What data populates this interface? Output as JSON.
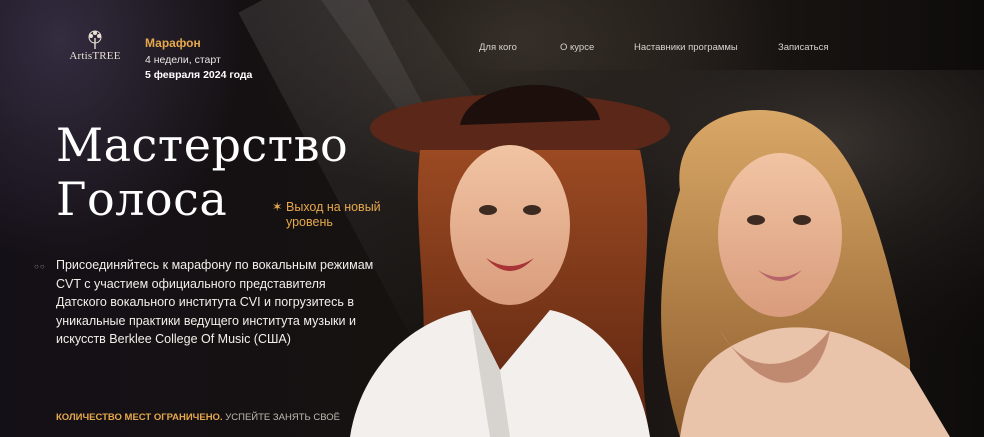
{
  "header": {
    "logo_text": "ArtisTREE",
    "marathon": {
      "title": "Марафон",
      "subtitle": "4 недели, старт",
      "date": "5 февраля 2024 года"
    },
    "nav": [
      {
        "label": "Для кого"
      },
      {
        "label": "О курсе"
      },
      {
        "label": "Наставники программы"
      },
      {
        "label": "Записаться"
      }
    ]
  },
  "hero": {
    "title_line1": "Мастерство",
    "title_line2": "Голоса",
    "tagline": "Выход на новый уровень",
    "description": "Присоединяйтесь к марафону по вокальным режимам CVT с участием официального представителя Датского вокального института CVI и погрузитесь в уникальные практики ведущего института музыки и искусств Berklee College Of Music (США)",
    "cta_bold": "КОЛИЧЕСТВО МЕСТ ОГРАНИЧЕНО.",
    "cta_rest": " УСПЕЙТЕ ЗАНЯТЬ СВОЁ"
  },
  "colors": {
    "accent": "#e6a84c",
    "background": "#0d0b0a",
    "text": "#ffffff"
  },
  "icons": [
    "tree-logo-icon",
    "star-icon",
    "dots-icon"
  ]
}
